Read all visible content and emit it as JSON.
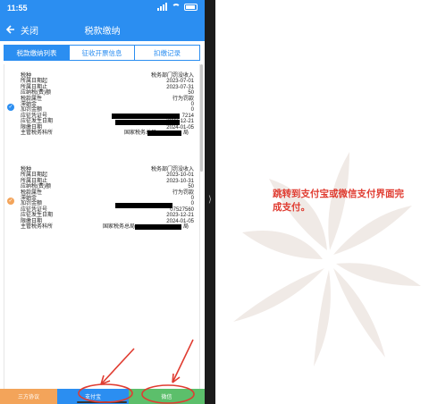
{
  "status_bar": {
    "time": "11:55"
  },
  "nav": {
    "back_label": "关闭",
    "title": "税款缴纳"
  },
  "tabs": [
    {
      "label": "税款缴纳列表",
      "active": true
    },
    {
      "label": "征收开票信息",
      "active": false
    },
    {
      "label": "扣缴记录",
      "active": false
    }
  ],
  "records": [
    {
      "rows": [
        {
          "label": "税种",
          "value": "税务部门罚没收入"
        },
        {
          "label": "所属日期起",
          "value": "2023-07-01"
        },
        {
          "label": "所属日期止",
          "value": "2023-07-31"
        },
        {
          "label": "应纳税(费)额",
          "value": "50"
        },
        {
          "label": "税款属性",
          "value": "行为罚款"
        },
        {
          "label": "滞纳金",
          "value": "0"
        },
        {
          "label": "加罚金额",
          "value": "0"
        },
        {
          "label": "应征凭证号",
          "value": "7214"
        },
        {
          "label": "应征发生日期",
          "value": "2023-12-21"
        },
        {
          "label": "限缴日期",
          "value": "2024-01-05"
        },
        {
          "label": "主管税务科所",
          "value": "国家税务总局"
        }
      ]
    },
    {
      "rows": [
        {
          "label": "税种",
          "value": "税务部门罚没收入"
        },
        {
          "label": "所属日期起",
          "value": "2023-10-01"
        },
        {
          "label": "所属日期止",
          "value": "2023-10-31"
        },
        {
          "label": "应纳税(费)额",
          "value": "50"
        },
        {
          "label": "税款属性",
          "value": "行为罚款"
        },
        {
          "label": "滞纳金",
          "value": "0"
        },
        {
          "label": "加罚金额",
          "value": "0"
        },
        {
          "label": "应征凭证号",
          "value": "07527560"
        },
        {
          "label": "应征发生日期",
          "value": "2023-12-21"
        },
        {
          "label": "限缴日期",
          "value": "2024-01-05"
        },
        {
          "label": "主管税务科所",
          "value": "国家税务总局"
        }
      ]
    }
  ],
  "bottom_buttons": {
    "third_party": "三方协议",
    "alipay": "支付宝",
    "wechat": "微信"
  },
  "instruction_text": "跳转到支付宝或微信支付界面完成支付。",
  "colors": {
    "primary": "#2b8ef1",
    "third_party": "#f3a45a",
    "wechat": "#5cbf6b",
    "annotation": "#e03c31"
  }
}
